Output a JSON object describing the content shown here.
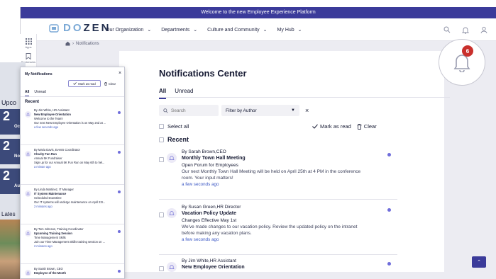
{
  "banner": "Welcome to the new Employee Experience Platform",
  "logo": {
    "light": "DO",
    "dark": "ZEN"
  },
  "nav": [
    {
      "label": "Our Organization"
    },
    {
      "label": "Departments"
    },
    {
      "label": "Culture and Community"
    },
    {
      "label": "My Hub"
    }
  ],
  "rail": [
    {
      "label": "Apps",
      "icon": "grid-icon"
    },
    {
      "label": "Bookmarks",
      "icon": "bookmark-icon"
    }
  ],
  "breadcrumb": "Notifications",
  "page_title": "Notifications Center",
  "tabs": [
    "All",
    "Unread"
  ],
  "search_placeholder": "Search",
  "filter_label": "Filter by Author",
  "select_all": "Select all",
  "mark_as_read": "Mark as read",
  "clear": "Clear",
  "recent": "Recent",
  "badge_count": "6",
  "notifications": [
    {
      "from": "By Sarah Brown,CEO",
      "title": "Monthly Town Hall Meeting",
      "subtitle": "Open Forum for Employees",
      "message": "Our next Monthly Town Hall Meeting will be held on April 25th at 4 PM in the conference room. Your input matters!",
      "time": "a few seconds ago"
    },
    {
      "from": "By Susan Green,HR Director",
      "title": "Vacation Policy Update",
      "subtitle": "Changes Effective May 1st",
      "message": "We've made changes to our vacation policy. Review the updated policy on the intranet before making any vacation plans.",
      "time": "a few seconds ago"
    },
    {
      "from": "By Jim White,HR Assistant",
      "title": "New Employee Orientation",
      "subtitle": "",
      "message": "",
      "time": ""
    }
  ],
  "popup": {
    "title": "My Notifications",
    "mark_as_read": "Mark as read",
    "clear": "Clear",
    "tabs": [
      "All",
      "Unread"
    ],
    "recent": "Recent",
    "items": [
      {
        "from": "By Jim White, HR Assistant",
        "title": "New Employee Orientation",
        "subtitle": "Welcome to the Team!",
        "message": "Our next New Employee Orientation is on May 2nd at ...",
        "time": "a few seconds ago"
      },
      {
        "from": "By Maria Davis, Events Coordinator",
        "title": "Charity Fun Run",
        "subtitle": "Annual 5K Fundraiser",
        "message": "Sign up for our Annual 5K Fun Run on May 6th to hel...",
        "time": "a minute ago"
      },
      {
        "from": "By Linda Martinez, IT Manager",
        "title": "IT System Maintenance",
        "subtitle": "Scheduled Downtime",
        "message": "Our IT systems will undergo maintenance on April 23r...",
        "time": "2 minutes ago"
      },
      {
        "from": "By Tom Johnson, Training Coordinator",
        "title": "Upcoming Training Session",
        "subtitle": "Time Management Skills",
        "message": "Join our Time Management Skills training session on ...",
        "time": "2 minutes ago"
      },
      {
        "from": "By Sarah Brown, CEO",
        "title": "Employee of the Month",
        "subtitle": "",
        "message": "",
        "time": ""
      }
    ]
  },
  "behind": {
    "upcoming": "Upco",
    "latest": "Lates",
    "n1": "2",
    "n2": "2",
    "n3": "2",
    "l1": "Oc",
    "l2": "No",
    "l3": "Au"
  }
}
